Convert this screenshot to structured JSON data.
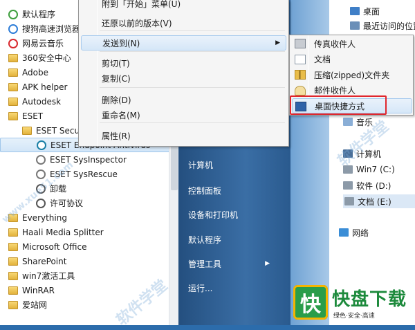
{
  "programs": [
    {
      "label": "默认程序",
      "icon": "default-programs-icon",
      "indent": 0,
      "folder": false
    },
    {
      "label": "搜狗高速浏览器",
      "icon": "sogou-browser-icon",
      "indent": 0,
      "folder": false
    },
    {
      "label": "网易云音乐",
      "icon": "netease-music-icon",
      "indent": 0,
      "folder": false
    },
    {
      "label": "360安全中心",
      "icon": "folder-icon",
      "indent": 0,
      "folder": true
    },
    {
      "label": "Adobe",
      "icon": "folder-icon",
      "indent": 0,
      "folder": true
    },
    {
      "label": "APK helper",
      "icon": "folder-icon",
      "indent": 0,
      "folder": true
    },
    {
      "label": "Autodesk",
      "icon": "folder-icon",
      "indent": 0,
      "folder": true
    },
    {
      "label": "ESET",
      "icon": "folder-icon",
      "indent": 0,
      "folder": true
    },
    {
      "label": "ESET Secur",
      "icon": "folder-icon",
      "indent": 1,
      "folder": true
    },
    {
      "label": "ESET Endpoint Antivirus",
      "icon": "eset-icon",
      "indent": 2,
      "folder": false,
      "selected": true
    },
    {
      "label": "ESET SysInspector",
      "icon": "sysinspector-icon",
      "indent": 2,
      "folder": false
    },
    {
      "label": "ESET SysRescue",
      "icon": "sysrescue-icon",
      "indent": 2,
      "folder": false
    },
    {
      "label": "卸载",
      "icon": "uninstall-icon",
      "indent": 2,
      "folder": false
    },
    {
      "label": "许可协议",
      "icon": "license-icon",
      "indent": 2,
      "folder": false
    },
    {
      "label": "Everything",
      "icon": "folder-icon",
      "indent": 0,
      "folder": true
    },
    {
      "label": "Haali Media Splitter",
      "icon": "folder-icon",
      "indent": 0,
      "folder": true
    },
    {
      "label": "Microsoft Office",
      "icon": "folder-icon",
      "indent": 0,
      "folder": true
    },
    {
      "label": "SharePoint",
      "icon": "folder-icon",
      "indent": 0,
      "folder": true
    },
    {
      "label": "win7激活工具",
      "icon": "folder-icon",
      "indent": 0,
      "folder": true
    },
    {
      "label": "WinRAR",
      "icon": "folder-icon",
      "indent": 0,
      "folder": true
    },
    {
      "label": "爱站网",
      "icon": "folder-icon",
      "indent": 0,
      "folder": true
    }
  ],
  "start_right": {
    "items": [
      {
        "label": "计算机",
        "arrow": false
      },
      {
        "label": "控制面板",
        "arrow": false
      },
      {
        "label": "设备和打印机",
        "arrow": false
      },
      {
        "label": "默认程序",
        "arrow": false
      },
      {
        "label": "管理工具",
        "arrow": true
      },
      {
        "label": "运行...",
        "arrow": false
      }
    ]
  },
  "context_menu": {
    "items": [
      {
        "label": "附到「开始」菜单(U)",
        "submenu": false
      },
      {
        "label": "还原以前的版本(V)",
        "submenu": false
      },
      {
        "label": "发送到(N)",
        "submenu": true,
        "hover": true
      },
      {
        "label": "剪切(T)",
        "submenu": false
      },
      {
        "label": "复制(C)",
        "submenu": false
      },
      {
        "label": "删除(D)",
        "submenu": false
      },
      {
        "label": "重命名(M)",
        "submenu": false
      },
      {
        "label": "属性(R)",
        "submenu": false
      }
    ]
  },
  "send_to": {
    "items": [
      {
        "label": "传真收件人",
        "icon": "fax-icon"
      },
      {
        "label": "文档",
        "icon": "documents-icon"
      },
      {
        "label": "压缩(zipped)文件夹",
        "icon": "zip-folder-icon"
      },
      {
        "label": "邮件收件人",
        "icon": "mail-icon"
      },
      {
        "label": "桌面快捷方式",
        "icon": "desktop-shortcut-icon",
        "hover": true
      }
    ]
  },
  "explorer": {
    "items": [
      {
        "label": "桌面",
        "icon": "desktop-icon"
      },
      {
        "label": "最近访问的位置",
        "icon": "recent-places-icon"
      },
      {
        "label": "音乐",
        "icon": "music-icon"
      },
      {
        "label": "计算机",
        "icon": "computer-icon"
      },
      {
        "label": "Win7 (C:)",
        "icon": "drive-icon"
      },
      {
        "label": "软件 (D:)",
        "icon": "drive-icon"
      },
      {
        "label": "文档 (E:)",
        "icon": "drive-icon",
        "selected": true
      },
      {
        "label": "网络",
        "icon": "network-icon"
      }
    ]
  },
  "watermark": "软件学堂",
  "watermark_url": "www.xue51.com",
  "logo": {
    "mark": "快",
    "name": "快盘下载",
    "tagline": "绿色·安全·高速"
  },
  "colors": {
    "highlight_box": "#e0262c",
    "menu_hover": "#d6e7f8",
    "start_blue": "#3a6ea5"
  }
}
